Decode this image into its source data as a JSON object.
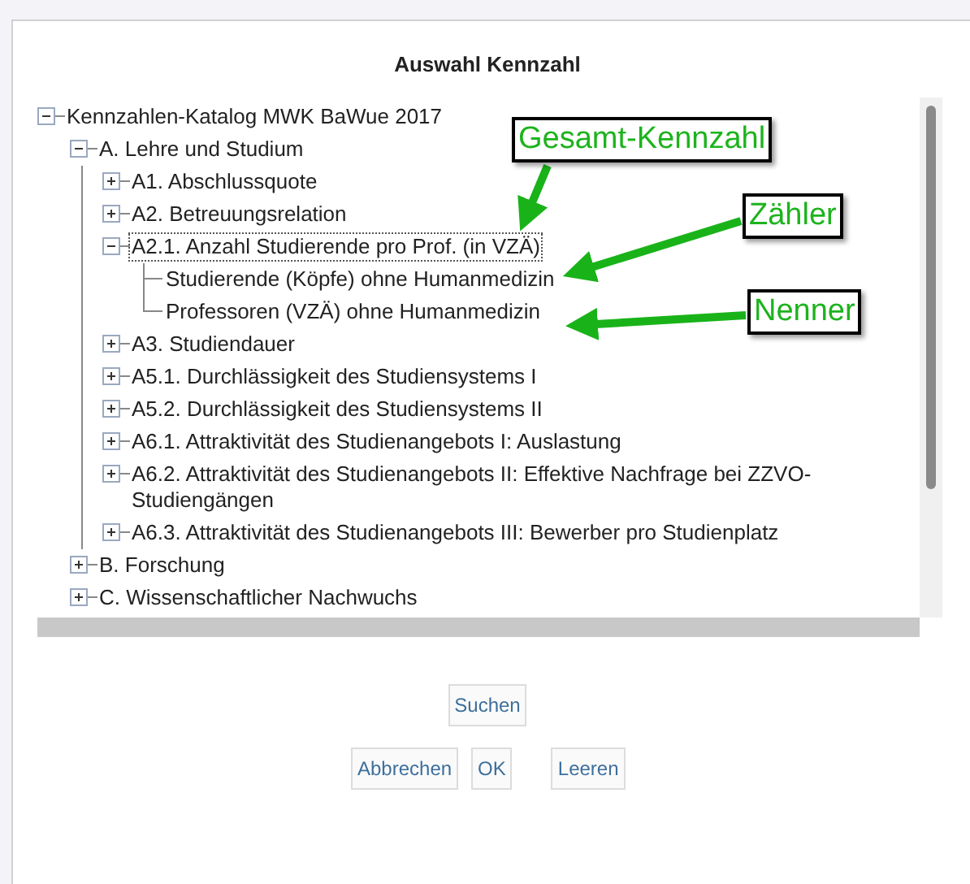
{
  "dialog": {
    "title": "Auswahl Kennzahl"
  },
  "tree": [
    {
      "label": "Kennzahlen-Katalog MWK BaWue 2017",
      "kind": "group",
      "expanded": true,
      "selected": false,
      "children": [
        {
          "label": "A. Lehre und Studium",
          "kind": "group",
          "expanded": true,
          "selected": false,
          "children": [
            {
              "label": "A1. Abschlussquote",
              "kind": "group",
              "expanded": false,
              "selected": false
            },
            {
              "label": "A2. Betreuungsrelation",
              "kind": "group",
              "expanded": false,
              "selected": false
            },
            {
              "label": "A2.1. Anzahl Studierende pro Prof. (in VZÄ)",
              "kind": "group",
              "expanded": true,
              "selected": true,
              "children": [
                {
                  "label": "Studierende (Köpfe) ohne Humanmedizin",
                  "kind": "leaf",
                  "selected": false
                },
                {
                  "label": "Professoren (VZÄ) ohne Humanmedizin",
                  "kind": "leaf",
                  "selected": false
                }
              ]
            },
            {
              "label": "A3. Studiendauer",
              "kind": "group",
              "expanded": false,
              "selected": false
            },
            {
              "label": "A5.1. Durchlässigkeit des Studiensystems I",
              "kind": "group",
              "expanded": false,
              "selected": false
            },
            {
              "label": "A5.2. Durchlässigkeit des Studiensystems II",
              "kind": "group",
              "expanded": false,
              "selected": false
            },
            {
              "label": "A6.1. Attraktivität des Studienangebots I: Auslastung",
              "kind": "group",
              "expanded": false,
              "selected": false
            },
            {
              "label": "A6.2. Attraktivität des Studienangebots II: Effektive Nachfrage bei ZZVO-Studiengängen",
              "kind": "group",
              "expanded": false,
              "selected": false
            },
            {
              "label": "A6.3. Attraktivität des Studienangebots III: Bewerber pro Studienplatz",
              "kind": "group",
              "expanded": false,
              "selected": false
            }
          ]
        },
        {
          "label": "B. Forschung",
          "kind": "group",
          "expanded": false,
          "selected": false
        },
        {
          "label": "C. Wissenschaftlicher Nachwuchs",
          "kind": "group",
          "expanded": false,
          "selected": false
        }
      ]
    }
  ],
  "annotations": [
    {
      "label": "Gesamt-Kennzahl"
    },
    {
      "label": "Zähler"
    },
    {
      "label": "Nenner"
    }
  ],
  "search_button": {
    "label": "Suchen"
  },
  "buttons": [
    {
      "label": "Abbrechen"
    },
    {
      "label": "OK"
    },
    {
      "label": "Leeren"
    }
  ]
}
